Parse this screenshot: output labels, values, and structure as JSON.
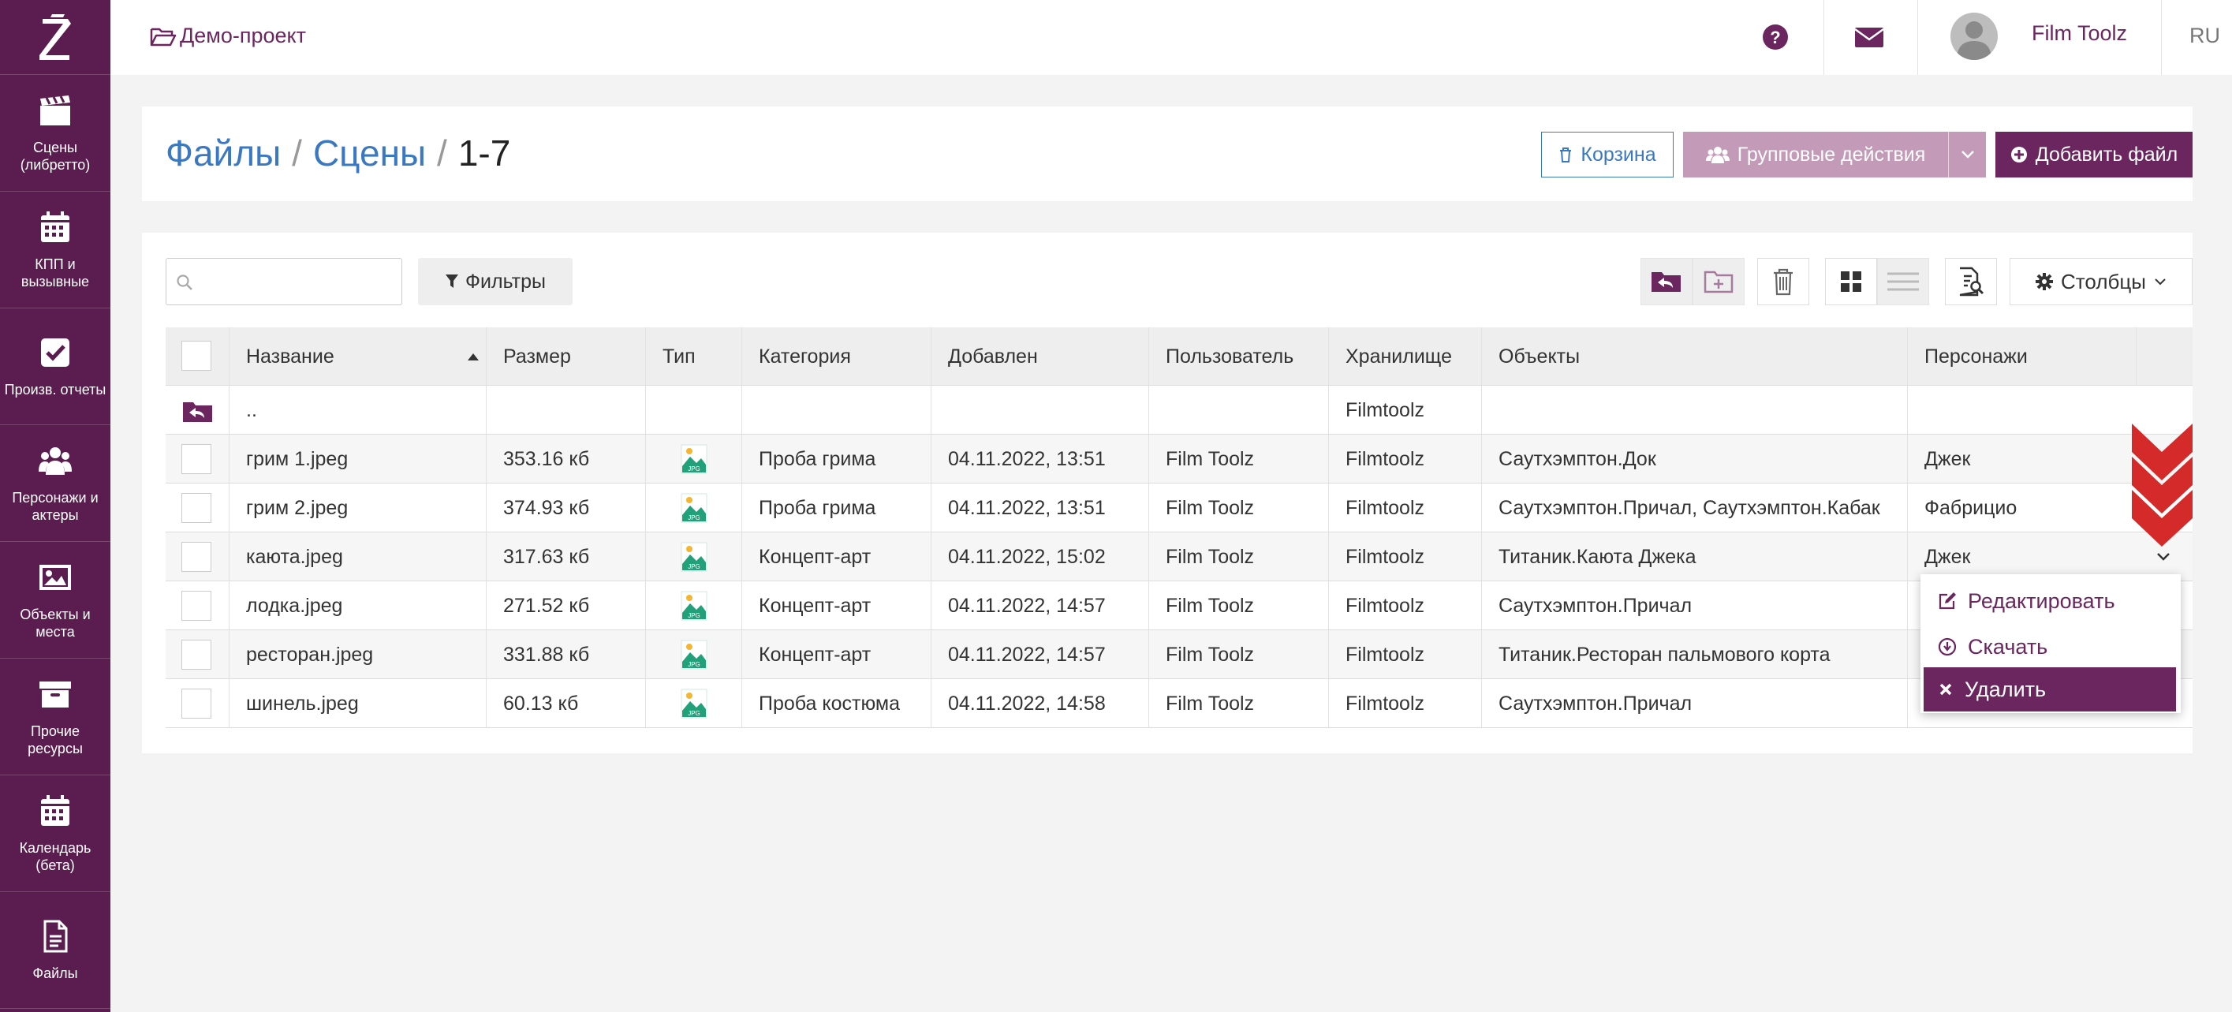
{
  "sidebar": {
    "logo": "Z",
    "items": [
      {
        "label": "Сцены (либретто)",
        "icon": "clapperboard-icon"
      },
      {
        "label": "КПП и вызывные",
        "icon": "calendar-icon"
      },
      {
        "label": "Произв. отчеты",
        "icon": "checkbox-icon"
      },
      {
        "label": "Персонажи и актеры",
        "icon": "users-icon"
      },
      {
        "label": "Объекты и места",
        "icon": "image-icon"
      },
      {
        "label": "Прочие ресурсы",
        "icon": "archive-icon"
      },
      {
        "label": "Календарь (бета)",
        "icon": "calendar-icon"
      },
      {
        "label": "Файлы",
        "icon": "file-icon"
      }
    ]
  },
  "topbar": {
    "project": "Демо-проект",
    "user_name": "Film Toolz",
    "lang": "RU"
  },
  "breadcrumb": {
    "files": "Файлы",
    "scenes": "Сцены",
    "current": "1-7",
    "separator": "/"
  },
  "actions": {
    "trash": "Корзина",
    "group": "Групповые действия",
    "add_file": "Добавить файл"
  },
  "toolbar": {
    "search_placeholder": "",
    "filters": "Фильтры",
    "columns": "Столбцы"
  },
  "table": {
    "columns": [
      "Название",
      "Размер",
      "Тип",
      "Категория",
      "Добавлен",
      "Пользователь",
      "Хранилище",
      "Объекты",
      "Персонажи"
    ],
    "parent_row": {
      "name": "..",
      "storage": "Filmtoolz"
    },
    "rows": [
      {
        "name": "грим 1.jpeg",
        "size": "353.16 кб",
        "type": "JPG",
        "category": "Проба грима",
        "added": "04.11.2022, 13:51",
        "user": "Film Toolz",
        "storage": "Filmtoolz",
        "objects": "Саутхэмптон.Док",
        "characters": "Джек"
      },
      {
        "name": "грим 2.jpeg",
        "size": "374.93 кб",
        "type": "JPG",
        "category": "Проба грима",
        "added": "04.11.2022, 13:51",
        "user": "Film Toolz",
        "storage": "Filmtoolz",
        "objects": "Саутхэмптон.Причал, Саутхэмптон.Кабак",
        "characters": "Фабрицио"
      },
      {
        "name": "каюта.jpeg",
        "size": "317.63 кб",
        "type": "JPG",
        "category": "Концепт-арт",
        "added": "04.11.2022, 15:02",
        "user": "Film Toolz",
        "storage": "Filmtoolz",
        "objects": "Титаник.Каюта Джека",
        "characters": "Джек"
      },
      {
        "name": "лодка.jpeg",
        "size": "271.52 кб",
        "type": "JPG",
        "category": "Концепт-арт",
        "added": "04.11.2022, 14:57",
        "user": "Film Toolz",
        "storage": "Filmtoolz",
        "objects": "Саутхэмптон.Причал",
        "characters": ""
      },
      {
        "name": "ресторан.jpeg",
        "size": "331.88 кб",
        "type": "JPG",
        "category": "Концепт-арт",
        "added": "04.11.2022, 14:57",
        "user": "Film Toolz",
        "storage": "Filmtoolz",
        "objects": "Титаник.Ресторан пальмового корта",
        "characters": ""
      },
      {
        "name": "шинель.jpeg",
        "size": "60.13 кб",
        "type": "JPG",
        "category": "Проба костюма",
        "added": "04.11.2022, 14:58",
        "user": "Film Toolz",
        "storage": "Filmtoolz",
        "objects": "Саутхэмптон.Причал",
        "characters": ""
      }
    ]
  },
  "context_menu": {
    "edit": "Редактировать",
    "download": "Скачать",
    "delete": "Удалить"
  },
  "colors": {
    "brand": "#5b1d4f",
    "accent": "#6b2660",
    "link": "#3a78c2",
    "indicator": "#d42a2a"
  }
}
